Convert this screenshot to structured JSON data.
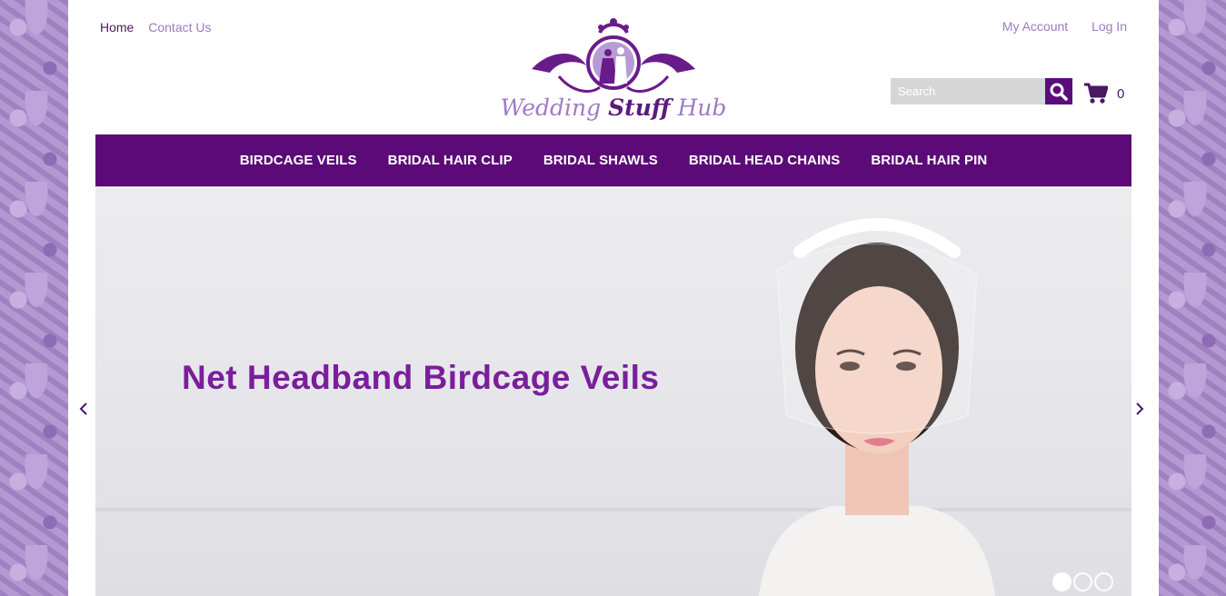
{
  "header": {
    "top_links": [
      "Home",
      "Contact Us"
    ],
    "account_links": [
      "My Account",
      "Log In"
    ],
    "logo_text_part1": "Wedding ",
    "logo_text_part2": "Stuff",
    "logo_text_part3": " Hub"
  },
  "search": {
    "placeholder": "Search"
  },
  "cart": {
    "count": "0"
  },
  "nav": {
    "items": [
      "BIRDCAGE VEILS",
      "BRIDAL HAIR CLIP",
      "BRIDAL SHAWLS",
      "BRIDAL HEAD CHAINS",
      "BRIDAL HAIR PIN"
    ]
  },
  "banner": {
    "title": "Net Headband Birdcage Veils",
    "prev_icon": "chevron-left-icon",
    "next_icon": "chevron-right-icon",
    "slide_count": 3,
    "active_slide": 1
  },
  "colors": {
    "brand_purple": "#5c0a78",
    "light_purple": "#9b7cbf",
    "banner_title": "#7a1e9c"
  }
}
